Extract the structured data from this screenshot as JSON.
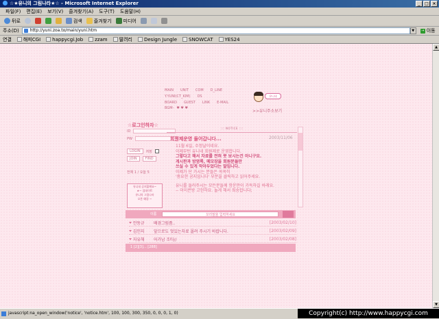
{
  "window": {
    "title": "☆★유니의 그림나라★☆ - Microsoft Internet Explorer",
    "minimize": "_",
    "maximize": "□",
    "close": "×"
  },
  "menu": [
    "파일(F)",
    "편집(E)",
    "보기(V)",
    "즐겨찾기(A)",
    "도구(T)",
    "도움말(H)"
  ],
  "toolbar": {
    "back": "뒤로",
    "search": "검색",
    "favorites": "즐겨찾기",
    "media": "미디어"
  },
  "address": {
    "label": "주소(D)",
    "url": "http://yuni.zoa.to/main/yuni.htm",
    "go": "이동"
  },
  "links": {
    "label": "연결",
    "items": [
      "해피CGI",
      "happycgi.Job",
      "zzam",
      "딸려리",
      "Design Jungle",
      "SNOWCAT",
      "YES24"
    ]
  },
  "site_nav": {
    "row1": [
      "MAIN",
      "UNIT",
      "COM",
      "D_LINE"
    ],
    "row2": [
      "Y.YUNI(CT_KIM)",
      "DS"
    ],
    "row3": [
      "BOARD",
      "GUEST",
      "LINK",
      "E-MAIL"
    ],
    "row4": "BGM-",
    "hearts": "♥ ♥ ♥"
  },
  "avatar_bubble": "유니네",
  "more_link": ">>유니주소보기",
  "login": {
    "title": "☆로그인하자☆",
    "id_label": "ID",
    "pw_label": "PW",
    "login_btn": "LOGIN",
    "save_label": "저장",
    "join_btn": "JOIN",
    "find_btn": "FIND",
    "visit": "전체 1 / 오늘 5"
  },
  "notice_box": {
    "lines": [
      "유니네 공지할께요~",
      "★~ 업데이트",
      "유니의 그림나라",
      "오픈 예정 ~"
    ]
  },
  "board": {
    "header": "::: NOTICE :::",
    "post_title": "회원제운영 들어갑니다...",
    "post_date": "2003/11/06",
    "lines": [
      {
        "text": "11월 6일, 수정날이네요.",
        "bold": false
      },
      {
        "text": "이제부턴 유니네 회원제로 운영합니다.",
        "bold": false
      },
      {
        "text": "그렇다고 해서 자료를 전혀 못 보시는건 아니구요.",
        "bold": true
      },
      {
        "text": "게시판과 방명록, 메모장을 회원분들만",
        "bold": true
      },
      {
        "text": "쓰실 수 있게 막아두었다는 말입니다.",
        "bold": true
      },
      {
        "text": "이제가 단 가시는 분들은 꼭꼭히",
        "bold": false
      },
      {
        "text": "'중요한 공지입니다' 부분을 클릭하고 읽어주세요.",
        "bold": false
      },
      {
        "text": "",
        "bold": false
      },
      {
        "text": "유니를 들러주시는 모든분들께 항운만이 가득하길 바래요.",
        "bold": false
      },
      {
        "text": "-- 이이콘방 고헌하요. 놀게 해서 죄송합니다;",
        "bold": false
      }
    ]
  },
  "reply": {
    "label": "이름",
    "hint": "꼬리말을 입력하세요"
  },
  "comments": [
    {
      "who": "안동규",
      "text": "배경그림좀..",
      "date": "[2003/02/10]"
    },
    {
      "who": "김민지",
      "text": "앞으로도 멋있는자료 올려 주시기 바랍니다.",
      "date": "[2003/02/09]"
    },
    {
      "who": "자유해",
      "text": "어가남 조타//",
      "date": "[2003/02/08]"
    }
  ],
  "pager": "1 [2][3]... [288]",
  "status": "javascript:na_open_window('notice', 'notice.htm', 100, 100, 300, 350, 0, 0, 0, 1, 0)",
  "copyright": "Copyright(c) http://www.happycgi.com"
}
